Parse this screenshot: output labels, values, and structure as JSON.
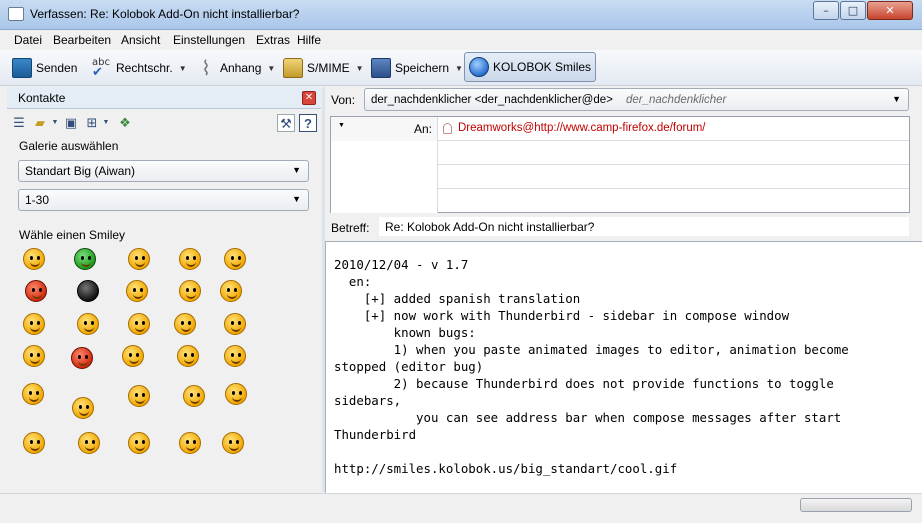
{
  "window": {
    "title": "Verfassen: Re: Kolobok Add-On nicht installierbar?",
    "minimize": "–",
    "maximize": "□",
    "close": "✕"
  },
  "menu": [
    "Datei",
    "Bearbeiten",
    "Ansicht",
    "Einstellungen",
    "Extras",
    "Hilfe"
  ],
  "toolbar": {
    "send": "Senden",
    "spell": "Rechtschr.",
    "attach": "Anhang",
    "smime": "S/MIME",
    "save": "Speichern",
    "kolobok": "KOLOBOK Smiles"
  },
  "sidebar": {
    "title": "Kontakte",
    "close": "✕",
    "gallery_label": "Galerie auswählen",
    "gallery_value": "Standart Big (Aiwan)",
    "range_value": "1-30",
    "pick_label": "Wähle einen Smiley",
    "icons": [
      "properties-icon",
      "folder-icon",
      "save-icon",
      "tree-icon",
      "shapes-icon",
      "tools-icon",
      "help-icon"
    ],
    "help": "?"
  },
  "header": {
    "from_label": "Von:",
    "from_value": "der_nachdenklicher <der_nachdenklicher@de>",
    "from_hint": "der_nachdenklicher",
    "to_label": "An:",
    "to_value": "Dreamworks@http://www.camp-firefox.de/forum/",
    "subject_label": "Betreff:",
    "subject_value": "Re: Kolobok Add-On nicht installierbar?"
  },
  "body": "2010/12/04 - v 1.7\n  en:\n    [+] added spanish translation\n    [+] now work with Thunderbird - sidebar in compose window\n        known bugs:\n        1) when you paste animated images to editor, animation become\nstopped (editor bug)\n        2) because Thunderbird does not provide functions to toggle\nsidebars,\n           you can see address bar when compose messages after start\nThunderbird\n\nhttp://smiles.kolobok.us/big_standart/cool.gif"
}
